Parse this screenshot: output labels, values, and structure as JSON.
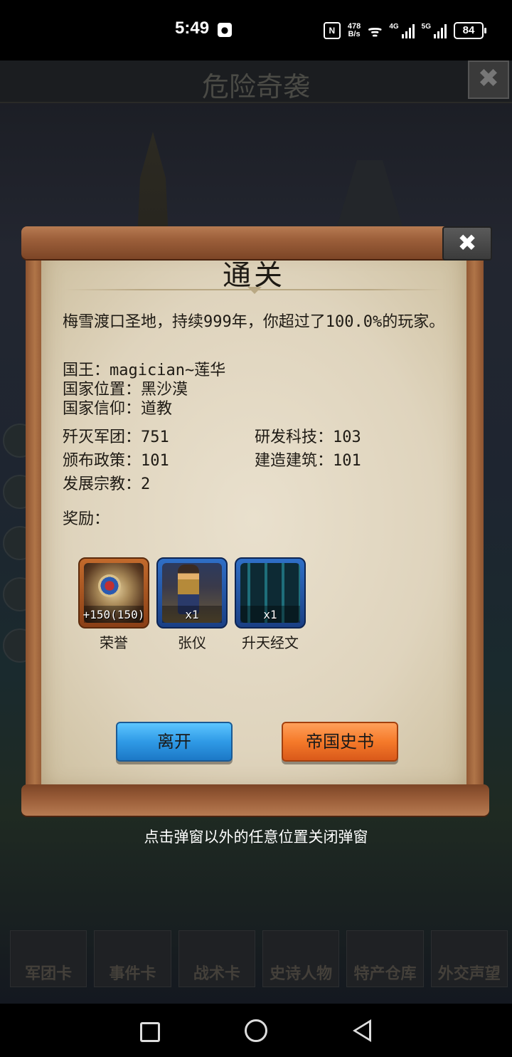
{
  "status_bar": {
    "time": "5:49",
    "speed_top": "478",
    "speed_bottom": "B/s",
    "net1": "4G",
    "net2": "5G",
    "battery": "84"
  },
  "background": {
    "title": "危险奇袭",
    "tabs": [
      "军团卡",
      "事件卡",
      "战术卡",
      "史诗人物",
      "特产仓库",
      "外交声望"
    ]
  },
  "dialog": {
    "title": "通关",
    "summary": "梅雪渡口圣地，持续999年，你超过了100.0%的玩家。",
    "king": "国王：magician~莲华",
    "location": "国家位置：黑沙漠",
    "faith": "国家信仰：道教",
    "stats": {
      "destroyed": "歼灭军团：751",
      "research": "研发科技：103",
      "policies": "颁布政策：101",
      "buildings": "建造建筑：101",
      "religion": "发展宗教：2"
    },
    "rewards_label": "奖励：",
    "rewards": [
      {
        "name": "荣誉",
        "count": "+150(150)",
        "icon": "honor-medal-icon"
      },
      {
        "name": "张仪",
        "count": "x1",
        "icon": "hero-portrait-icon"
      },
      {
        "name": "升天经文",
        "count": "x1",
        "icon": "scripture-scroll-icon"
      }
    ],
    "buttons": {
      "leave": "离开",
      "history": "帝国史书"
    },
    "close_symbol": "✖"
  },
  "hint": "点击弹窗以外的任意位置关闭弹窗",
  "colors": {
    "leave_button": "#2f9ae6",
    "history_button": "#f57a2a",
    "parchment": "#e4dac4"
  }
}
